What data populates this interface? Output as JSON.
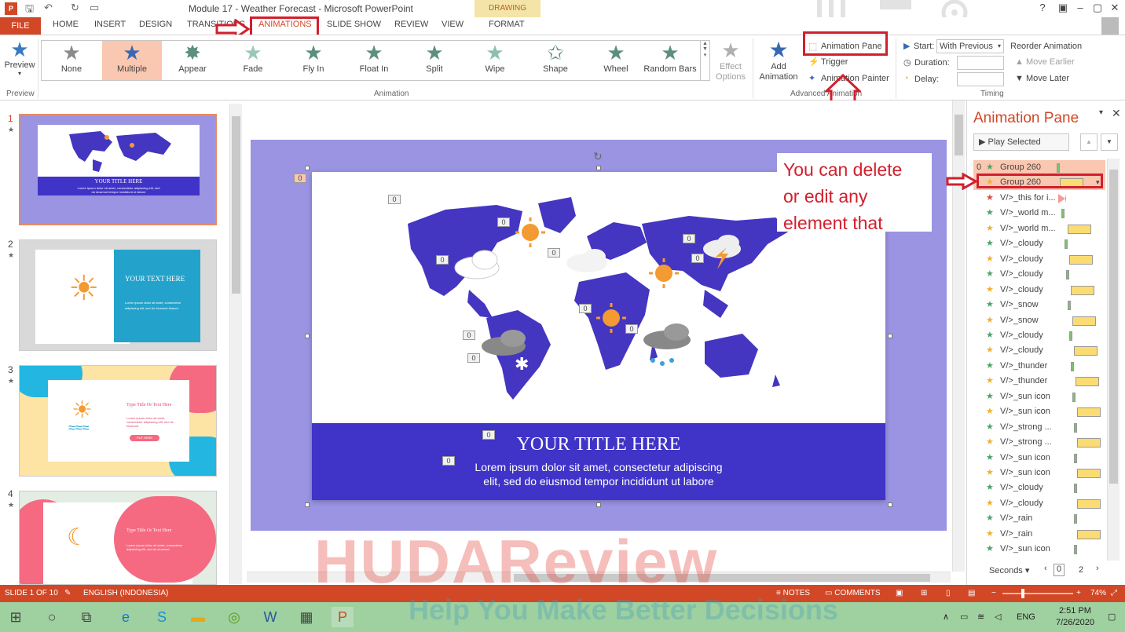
{
  "window": {
    "title": "Module 17 - Weather Forecast - Microsoft PowerPoint",
    "context_tab_group": "DRAWING TOOLS",
    "help": "?"
  },
  "tabs": [
    "FILE",
    "HOME",
    "INSERT",
    "DESIGN",
    "TRANSITIONS",
    "ANIMATIONS",
    "SLIDE SHOW",
    "REVIEW",
    "VIEW",
    "FORMAT"
  ],
  "active_tab": "ANIMATIONS",
  "ribbon": {
    "preview": {
      "label": "Preview",
      "group": "Preview"
    },
    "gallery": {
      "group": "Animation",
      "items": [
        "None",
        "Multiple",
        "Appear",
        "Fade",
        "Fly In",
        "Float In",
        "Split",
        "Wipe",
        "Shape",
        "Wheel",
        "Random Bars"
      ],
      "selected": "Multiple"
    },
    "effect_options": "Effect Options",
    "advanced": {
      "group": "Advanced Animation",
      "add_animation": "Add Animation",
      "animation_pane": "Animation Pane",
      "trigger": "Trigger",
      "animation_painter": "Animation Painter"
    },
    "timing": {
      "group": "Timing",
      "start_label": "Start:",
      "start_value": "With Previous",
      "duration_label": "Duration:",
      "delay_label": "Delay:",
      "reorder": "Reorder Animation",
      "move_earlier": "Move Earlier",
      "move_later": "Move Later"
    }
  },
  "thumbnails": [
    {
      "num": "1",
      "title": "YOUR TITLE HERE",
      "body": "Lorem ipsum dolor sit amet, consectetur adipiscing elit, sed do eiusmod tempor incididunt ut labore"
    },
    {
      "num": "2",
      "title": "YOUR TEXT HERE",
      "body": "Lorem ipsum dolor sit amet, consectetur adipiscing elit, sed do eiusmod tempor"
    },
    {
      "num": "3",
      "title": "Type Title Or Text Here",
      "body": "Lorem ipsum dolor sit amet, consectetur adipiscing elit, sed do eiusmod",
      "button": "PUT HERE"
    },
    {
      "num": "4",
      "title": "Type Title Or Text Here",
      "body": "Lorem ipsum dolor sit amet, consectetur adipiscing elit, sed do eiusmod"
    }
  ],
  "slide": {
    "title": "YOUR TITLE HERE",
    "subtitle_line1": "Lorem ipsum dolor sit amet, consectetur adipiscing",
    "subtitle_line2": "elit, sed do eiusmod tempor incididunt ut labore",
    "tag": "0"
  },
  "callout": {
    "line1": "You can delete",
    "line2": "or edit any",
    "line3": "element that"
  },
  "anim_pane": {
    "title": "Animation Pane",
    "play": "Play Selected",
    "items": [
      {
        "num": "0",
        "name": "Group 260",
        "bar": "g",
        "star": "green"
      },
      {
        "num": "",
        "name": "Group 260",
        "bar": "y",
        "star": "yellow"
      },
      {
        "num": "",
        "name": "V/>_this for i...",
        "bar": "r",
        "star": "red"
      },
      {
        "num": "",
        "name": "V/>_world m...",
        "bar": "g",
        "star": "green"
      },
      {
        "num": "",
        "name": "V/>_world m...",
        "bar": "y",
        "star": "yellow"
      },
      {
        "num": "",
        "name": "V/>_cloudy",
        "bar": "g",
        "star": "green"
      },
      {
        "num": "",
        "name": "V/>_cloudy",
        "bar": "y",
        "star": "yellow"
      },
      {
        "num": "",
        "name": "V/>_cloudy",
        "bar": "g",
        "star": "green"
      },
      {
        "num": "",
        "name": "V/>_cloudy",
        "bar": "y",
        "star": "yellow"
      },
      {
        "num": "",
        "name": "V/>_snow",
        "bar": "g",
        "star": "green"
      },
      {
        "num": "",
        "name": "V/>_snow",
        "bar": "y",
        "star": "yellow"
      },
      {
        "num": "",
        "name": "V/>_cloudy",
        "bar": "g",
        "star": "green"
      },
      {
        "num": "",
        "name": "V/>_cloudy",
        "bar": "y",
        "star": "yellow"
      },
      {
        "num": "",
        "name": "V/>_thunder",
        "bar": "g",
        "star": "green"
      },
      {
        "num": "",
        "name": "V/>_thunder",
        "bar": "y",
        "star": "yellow"
      },
      {
        "num": "",
        "name": "V/>_sun icon",
        "bar": "g",
        "star": "green"
      },
      {
        "num": "",
        "name": "V/>_sun icon",
        "bar": "y",
        "star": "yellow"
      },
      {
        "num": "",
        "name": "V/>_strong ...",
        "bar": "g",
        "star": "green"
      },
      {
        "num": "",
        "name": "V/>_strong ...",
        "bar": "y",
        "star": "yellow"
      },
      {
        "num": "",
        "name": "V/>_sun icon",
        "bar": "g",
        "star": "green"
      },
      {
        "num": "",
        "name": "V/>_sun icon",
        "bar": "y",
        "star": "yellow"
      },
      {
        "num": "",
        "name": "V/>_cloudy",
        "bar": "g",
        "star": "green"
      },
      {
        "num": "",
        "name": "V/>_cloudy",
        "bar": "y",
        "star": "yellow"
      },
      {
        "num": "",
        "name": "V/>_rain",
        "bar": "g",
        "star": "green"
      },
      {
        "num": "",
        "name": "V/>_rain",
        "bar": "y",
        "star": "yellow"
      },
      {
        "num": "",
        "name": "V/>_sun icon",
        "bar": "g",
        "star": "green"
      },
      {
        "num": "",
        "name": "V/>_sun icon",
        "bar": "y",
        "star": "yellow"
      }
    ],
    "seconds": "Seconds",
    "timeline_0": "0",
    "timeline_2": "2"
  },
  "status": {
    "slide": "SLIDE 1 OF 10",
    "language": "ENGLISH (INDONESIA)",
    "notes": "NOTES",
    "comments": "COMMENTS",
    "zoom": "74%"
  },
  "taskbar": {
    "lang": "ENG",
    "time": "2:51 PM",
    "date": "7/26/2020"
  },
  "watermark": {
    "main": "HUDAReview",
    "tagline": "Help You Make Better Decisions"
  },
  "colors": {
    "accent": "#d24726",
    "annotation_red": "#d21f2d",
    "slide_blue": "#4033c8",
    "slide_lavender": "#9a94e2",
    "map_blue": "#4436c0",
    "sun_orange": "#f39a32"
  }
}
